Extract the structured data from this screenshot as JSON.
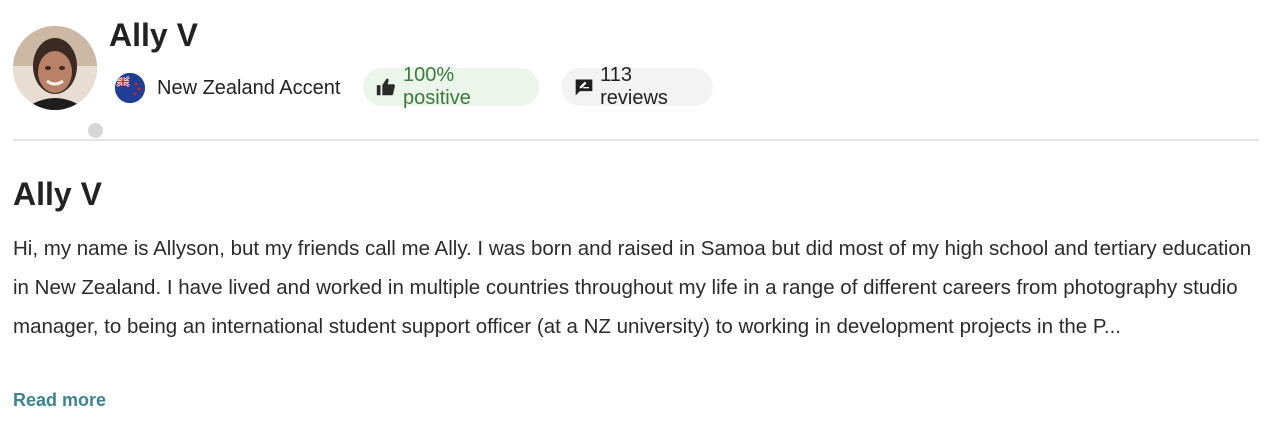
{
  "profile": {
    "name": "Ally V",
    "accent": {
      "label": "New Zealand Accent",
      "flag_icon": "new-zealand-flag-icon"
    },
    "rating": {
      "label": "100% positive",
      "icon": "thumbs-up-icon",
      "color": "#3b7a3b",
      "background": "#ecf5ec"
    },
    "reviews": {
      "label": "113 reviews",
      "icon": "review-icon"
    },
    "online_status_color": "#d6d6d6"
  },
  "bio": {
    "title": "Ally V",
    "text": "Hi, my name is Allyson, but my friends call me Ally. I was born and raised in Samoa but did most of my high school and tertiary education in New Zealand. I have lived and worked in multiple countries throughout my life in a range of different careers from photography studio manager, to being an international student support officer (at a NZ university) to working in development projects in the P...",
    "read_more_label": "Read more",
    "link_color": "#3a8494"
  }
}
